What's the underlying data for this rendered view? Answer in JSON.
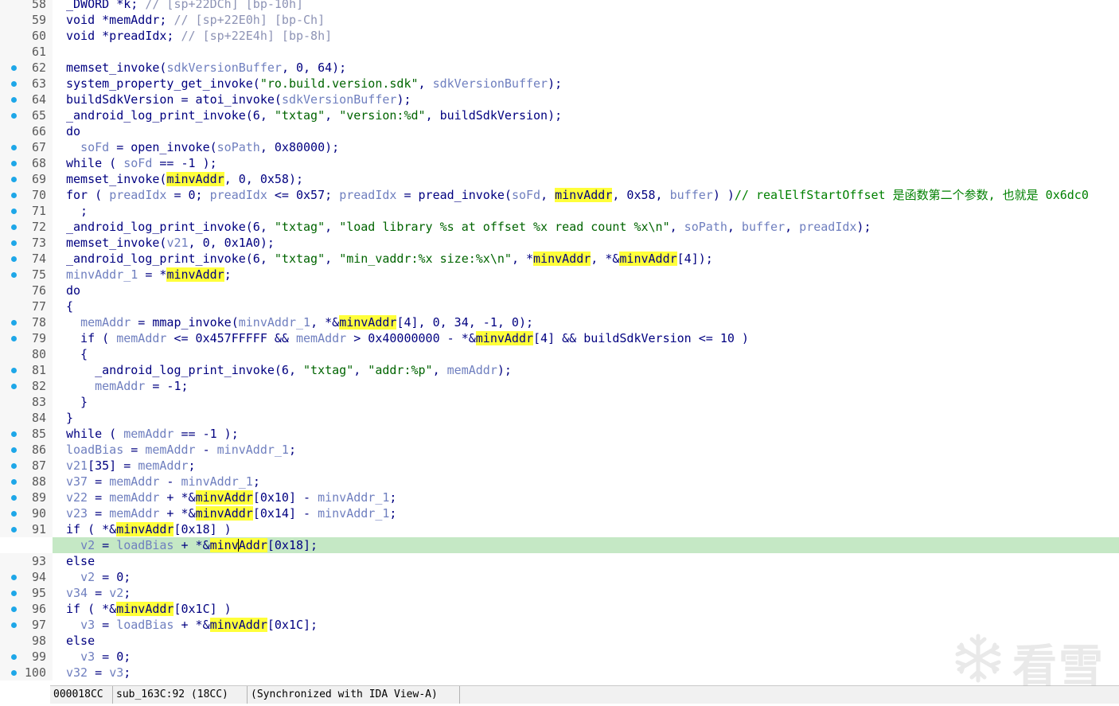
{
  "code_lines": [
    {
      "n": "58",
      "dot": false,
      "current": false,
      "code": [
        {
          "t": "_DWORD *k; "
        },
        {
          "t": "// [sp+22DCh] [bp-10h]",
          "k": "c"
        }
      ]
    },
    {
      "n": "59",
      "dot": false,
      "current": false,
      "code": [
        {
          "t": "void *memAddr; "
        },
        {
          "t": "// [sp+22E0h] [bp-Ch]",
          "k": "c"
        }
      ]
    },
    {
      "n": "60",
      "dot": false,
      "current": false,
      "code": [
        {
          "t": "void *preadIdx; "
        },
        {
          "t": "// [sp+22E4h] [bp-8h]",
          "k": "c"
        }
      ]
    },
    {
      "n": "61",
      "dot": false,
      "current": false,
      "code": []
    },
    {
      "n": "62",
      "dot": true,
      "current": false,
      "code": [
        {
          "t": "memset_invoke("
        },
        {
          "t": "sdkVersionBuffer",
          "k": "v"
        },
        {
          "t": ", 0, 64);"
        }
      ]
    },
    {
      "n": "63",
      "dot": true,
      "current": false,
      "code": [
        {
          "t": "system_property_get_invoke("
        },
        {
          "t": "\"ro.build.version.sdk\"",
          "k": "s"
        },
        {
          "t": ", "
        },
        {
          "t": "sdkVersionBuffer",
          "k": "v"
        },
        {
          "t": ");"
        }
      ]
    },
    {
      "n": "64",
      "dot": true,
      "current": false,
      "code": [
        {
          "t": "buildSdkVersion = atoi_invoke("
        },
        {
          "t": "sdkVersionBuffer",
          "k": "v"
        },
        {
          "t": ");"
        }
      ]
    },
    {
      "n": "65",
      "dot": true,
      "current": false,
      "code": [
        {
          "t": "_android_log_print_invoke(6, "
        },
        {
          "t": "\"txtag\"",
          "k": "s"
        },
        {
          "t": ", "
        },
        {
          "t": "\"version:%d\"",
          "k": "s"
        },
        {
          "t": ", buildSdkVersion);"
        }
      ]
    },
    {
      "n": "66",
      "dot": false,
      "current": false,
      "code": [
        {
          "t": "do"
        }
      ]
    },
    {
      "n": "67",
      "dot": true,
      "current": false,
      "code": [
        {
          "t": "  "
        },
        {
          "t": "soFd",
          "k": "v"
        },
        {
          "t": " = open_invoke("
        },
        {
          "t": "soPath",
          "k": "v"
        },
        {
          "t": ", 0x80000);"
        }
      ]
    },
    {
      "n": "68",
      "dot": true,
      "current": false,
      "code": [
        {
          "t": "while ( "
        },
        {
          "t": "soFd",
          "k": "v"
        },
        {
          "t": " == -1 );"
        }
      ]
    },
    {
      "n": "69",
      "dot": true,
      "current": false,
      "code": [
        {
          "t": "memset_invoke("
        },
        {
          "t": "minvAddr",
          "k": "h"
        },
        {
          "t": ", 0, 0x58);"
        }
      ]
    },
    {
      "n": "70",
      "dot": true,
      "current": false,
      "code": [
        {
          "t": "for ( "
        },
        {
          "t": "preadIdx",
          "k": "v"
        },
        {
          "t": " = 0; "
        },
        {
          "t": "preadIdx",
          "k": "v"
        },
        {
          "t": " <= 0x57; "
        },
        {
          "t": "preadIdx",
          "k": "v"
        },
        {
          "t": " = pread_invoke("
        },
        {
          "t": "soFd",
          "k": "v"
        },
        {
          "t": ", "
        },
        {
          "t": "minvAddr",
          "k": "h"
        },
        {
          "t": ", 0x58, "
        },
        {
          "t": "buffer",
          "k": "v"
        },
        {
          "t": ") )"
        },
        {
          "t": "// realElfStartOffset 是函数第二个参数, 也就是 0x6dc0",
          "k": "g"
        }
      ]
    },
    {
      "n": "71",
      "dot": true,
      "current": false,
      "code": [
        {
          "t": "  ;"
        }
      ]
    },
    {
      "n": "72",
      "dot": true,
      "current": false,
      "code": [
        {
          "t": "_android_log_print_invoke(6, "
        },
        {
          "t": "\"txtag\"",
          "k": "s"
        },
        {
          "t": ", "
        },
        {
          "t": "\"load library %s at offset %x read count %x\\n\"",
          "k": "s"
        },
        {
          "t": ", "
        },
        {
          "t": "soPath",
          "k": "v"
        },
        {
          "t": ", "
        },
        {
          "t": "buffer",
          "k": "v"
        },
        {
          "t": ", "
        },
        {
          "t": "preadIdx",
          "k": "v"
        },
        {
          "t": ");"
        }
      ]
    },
    {
      "n": "73",
      "dot": true,
      "current": false,
      "code": [
        {
          "t": "memset_invoke("
        },
        {
          "t": "v21",
          "k": "v"
        },
        {
          "t": ", 0, 0x1A0);"
        }
      ]
    },
    {
      "n": "74",
      "dot": true,
      "current": false,
      "code": [
        {
          "t": "_android_log_print_invoke(6, "
        },
        {
          "t": "\"txtag\"",
          "k": "s"
        },
        {
          "t": ", "
        },
        {
          "t": "\"min_vaddr:%x size:%x\\n\"",
          "k": "s"
        },
        {
          "t": ", *"
        },
        {
          "t": "minvAddr",
          "k": "h"
        },
        {
          "t": ", *&"
        },
        {
          "t": "minvAddr",
          "k": "h"
        },
        {
          "t": "[4]);"
        }
      ]
    },
    {
      "n": "75",
      "dot": true,
      "current": false,
      "code": [
        {
          "t": "minvAddr_1",
          "k": "v"
        },
        {
          "t": " = *"
        },
        {
          "t": "minvAddr",
          "k": "h"
        },
        {
          "t": ";"
        }
      ]
    },
    {
      "n": "76",
      "dot": false,
      "current": false,
      "code": [
        {
          "t": "do"
        }
      ]
    },
    {
      "n": "77",
      "dot": false,
      "current": false,
      "code": [
        {
          "t": "{"
        }
      ]
    },
    {
      "n": "78",
      "dot": true,
      "current": false,
      "code": [
        {
          "t": "  "
        },
        {
          "t": "memAddr",
          "k": "v"
        },
        {
          "t": " = mmap_invoke("
        },
        {
          "t": "minvAddr_1",
          "k": "v"
        },
        {
          "t": ", *&"
        },
        {
          "t": "minvAddr",
          "k": "h"
        },
        {
          "t": "[4], 0, 34, -1, 0);"
        }
      ]
    },
    {
      "n": "79",
      "dot": true,
      "current": false,
      "code": [
        {
          "t": "  if ( "
        },
        {
          "t": "memAddr",
          "k": "v"
        },
        {
          "t": " <= 0x457FFFFF && "
        },
        {
          "t": "memAddr",
          "k": "v"
        },
        {
          "t": " > 0x40000000 - *&"
        },
        {
          "t": "minvAddr",
          "k": "h"
        },
        {
          "t": "[4] && buildSdkVersion <= 10 )"
        }
      ]
    },
    {
      "n": "80",
      "dot": false,
      "current": false,
      "code": [
        {
          "t": "  {"
        }
      ]
    },
    {
      "n": "81",
      "dot": true,
      "current": false,
      "code": [
        {
          "t": "    _android_log_print_invoke(6, "
        },
        {
          "t": "\"txtag\"",
          "k": "s"
        },
        {
          "t": ", "
        },
        {
          "t": "\"addr:%p\"",
          "k": "s"
        },
        {
          "t": ", "
        },
        {
          "t": "memAddr",
          "k": "v"
        },
        {
          "t": ");"
        }
      ]
    },
    {
      "n": "82",
      "dot": true,
      "current": false,
      "code": [
        {
          "t": "    "
        },
        {
          "t": "memAddr",
          "k": "v"
        },
        {
          "t": " = -1;"
        }
      ]
    },
    {
      "n": "83",
      "dot": false,
      "current": false,
      "code": [
        {
          "t": "  }"
        }
      ]
    },
    {
      "n": "84",
      "dot": false,
      "current": false,
      "code": [
        {
          "t": "}"
        }
      ]
    },
    {
      "n": "85",
      "dot": true,
      "current": false,
      "code": [
        {
          "t": "while ( "
        },
        {
          "t": "memAddr",
          "k": "v"
        },
        {
          "t": " == -1 );"
        }
      ]
    },
    {
      "n": "86",
      "dot": true,
      "current": false,
      "code": [
        {
          "t": "loadBias",
          "k": "v"
        },
        {
          "t": " = "
        },
        {
          "t": "memAddr",
          "k": "v"
        },
        {
          "t": " - "
        },
        {
          "t": "minvAddr_1",
          "k": "v"
        },
        {
          "t": ";"
        }
      ]
    },
    {
      "n": "87",
      "dot": true,
      "current": false,
      "code": [
        {
          "t": "v21",
          "k": "v"
        },
        {
          "t": "[35] = "
        },
        {
          "t": "memAddr",
          "k": "v"
        },
        {
          "t": ";"
        }
      ]
    },
    {
      "n": "88",
      "dot": true,
      "current": false,
      "code": [
        {
          "t": "v37",
          "k": "v"
        },
        {
          "t": " = "
        },
        {
          "t": "memAddr",
          "k": "v"
        },
        {
          "t": " - "
        },
        {
          "t": "minvAddr_1",
          "k": "v"
        },
        {
          "t": ";"
        }
      ]
    },
    {
      "n": "89",
      "dot": true,
      "current": false,
      "code": [
        {
          "t": "v22",
          "k": "v"
        },
        {
          "t": " = "
        },
        {
          "t": "memAddr",
          "k": "v"
        },
        {
          "t": " + *&"
        },
        {
          "t": "minvAddr",
          "k": "h"
        },
        {
          "t": "[0x10] - "
        },
        {
          "t": "minvAddr_1",
          "k": "v"
        },
        {
          "t": ";"
        }
      ]
    },
    {
      "n": "90",
      "dot": true,
      "current": false,
      "code": [
        {
          "t": "v23",
          "k": "v"
        },
        {
          "t": " = "
        },
        {
          "t": "memAddr",
          "k": "v"
        },
        {
          "t": " + *&"
        },
        {
          "t": "minvAddr",
          "k": "h"
        },
        {
          "t": "[0x14] - "
        },
        {
          "t": "minvAddr_1",
          "k": "v"
        },
        {
          "t": ";"
        }
      ]
    },
    {
      "n": "91",
      "dot": true,
      "current": false,
      "code": [
        {
          "t": "if ( *&"
        },
        {
          "t": "minvAddr",
          "k": "h"
        },
        {
          "t": "[0x18] )"
        }
      ]
    },
    {
      "n": "92",
      "dot": true,
      "current": true,
      "code": [
        {
          "t": "  "
        },
        {
          "t": "v2",
          "k": "v"
        },
        {
          "t": " = "
        },
        {
          "t": "loadBias",
          "k": "v"
        },
        {
          "t": " + *&"
        },
        {
          "t": "minv",
          "k": "h"
        },
        {
          "t": "",
          "k": "caret"
        },
        {
          "t": "Addr",
          "k": "h"
        },
        {
          "t": "[0x18];"
        }
      ]
    },
    {
      "n": "93",
      "dot": false,
      "current": false,
      "code": [
        {
          "t": "else"
        }
      ]
    },
    {
      "n": "94",
      "dot": true,
      "current": false,
      "code": [
        {
          "t": "  "
        },
        {
          "t": "v2",
          "k": "v"
        },
        {
          "t": " = 0;"
        }
      ]
    },
    {
      "n": "95",
      "dot": true,
      "current": false,
      "code": [
        {
          "t": "v34",
          "k": "v"
        },
        {
          "t": " = "
        },
        {
          "t": "v2",
          "k": "v"
        },
        {
          "t": ";"
        }
      ]
    },
    {
      "n": "96",
      "dot": true,
      "current": false,
      "code": [
        {
          "t": "if ( *&"
        },
        {
          "t": "minvAddr",
          "k": "h"
        },
        {
          "t": "[0x1C] )"
        }
      ]
    },
    {
      "n": "97",
      "dot": true,
      "current": false,
      "code": [
        {
          "t": "  "
        },
        {
          "t": "v3",
          "k": "v"
        },
        {
          "t": " = "
        },
        {
          "t": "loadBias",
          "k": "v"
        },
        {
          "t": " + *&"
        },
        {
          "t": "minvAddr",
          "k": "h"
        },
        {
          "t": "[0x1C];"
        }
      ]
    },
    {
      "n": "98",
      "dot": false,
      "current": false,
      "code": [
        {
          "t": "else"
        }
      ]
    },
    {
      "n": "99",
      "dot": true,
      "current": false,
      "code": [
        {
          "t": "  "
        },
        {
          "t": "v3",
          "k": "v"
        },
        {
          "t": " = 0;"
        }
      ]
    },
    {
      "n": "100",
      "dot": true,
      "current": false,
      "code": [
        {
          "t": "v32",
          "k": "v"
        },
        {
          "t": " = "
        },
        {
          "t": "v3",
          "k": "v"
        },
        {
          "t": ";"
        }
      ]
    }
  ],
  "status_bar": {
    "address": "000018CC",
    "location": "sub_163C:92 (18CC)",
    "sync": "(Synchronized with IDA View-A)"
  },
  "watermark": {
    "text": "看雪",
    "icon": "snowflake-icon"
  },
  "colors": {
    "keyword": "#000080",
    "variable": "#6f7fbf",
    "string": "#006400",
    "comment": "#8d93b5",
    "highlight": "#ffff3a",
    "current_line": "#c5e8c5",
    "breakpoint_dot": "#1ea7e8"
  }
}
